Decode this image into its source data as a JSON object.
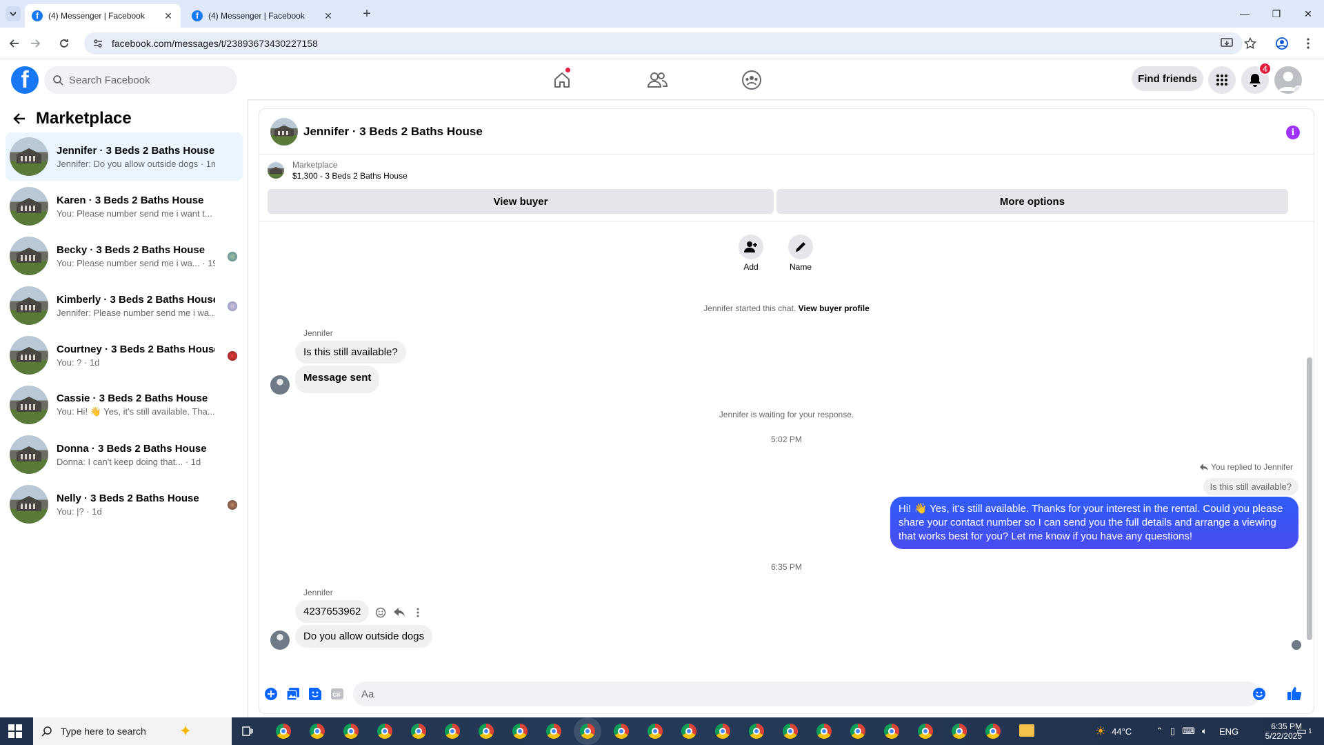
{
  "browser": {
    "tabs": [
      {
        "title": "(4) Messenger | Facebook",
        "active": true
      },
      {
        "title": "(4) Messenger | Facebook",
        "active": false
      }
    ],
    "url": "facebook.com/messages/t/23893673430227158"
  },
  "fb_header": {
    "search_placeholder": "Search Facebook",
    "find_friends": "Find friends",
    "notification_count": "4"
  },
  "sidebar": {
    "title": "Marketplace",
    "conversations": [
      {
        "name": "Jennifer · 3 Beds 2 Baths House",
        "preview": "Jennifer: Do you allow outside dogs · 1m",
        "selected": true
      },
      {
        "name": "Karen · 3 Beds 2 Baths House",
        "preview": "You: Please number send me i want t... · 1h"
      },
      {
        "name": "Becky · 3 Beds 2 Baths House",
        "preview": "You: Please number send me i wa... · 19h"
      },
      {
        "name": "Kimberly · 3 Beds 2 Baths House",
        "preview": "Jennifer: Please number send me i wa... · 19h"
      },
      {
        "name": "Courtney · 3 Beds 2 Baths House",
        "preview": "You: ? · 1d"
      },
      {
        "name": "Cassie · 3 Beds 2 Baths House",
        "preview": "You: Hi! 👋 Yes, it's still available. Tha... · 1d"
      },
      {
        "name": "Donna · 3 Beds 2 Baths House",
        "preview": "Donna: I can't keep doing that... · 1d"
      },
      {
        "name": "Nelly · 3 Beds 2 Baths House",
        "preview": "You: |? · 1d"
      }
    ]
  },
  "chat": {
    "title": "Jennifer · 3 Beds 2 Baths House",
    "listing_source": "Marketplace",
    "listing_title": "$1,300 - 3 Beds 2 Baths House",
    "view_buyer": "View buyer",
    "more_options": "More options",
    "add_label": "Add",
    "name_label": "Name",
    "started_text": "Jennifer started this chat.",
    "view_profile": "View buyer profile",
    "sender_name": "Jennifer",
    "msg1": "Is this still available?",
    "msg2": "Message sent",
    "waiting": "Jennifer is waiting for your response.",
    "time1": "5:02 PM",
    "replied_to": "You replied to Jennifer",
    "quoted": "Is this still available?",
    "my_reply": "Hi! 👋 Yes, it's still available. Thanks for your interest in the rental. Could you please share your contact number so I can send you the full details and arrange a viewing that works best for you? Let me know if you have any questions!",
    "time2": "6:35 PM",
    "msg3": "4237653962",
    "msg4": "Do you allow outside dogs",
    "composer_placeholder": "Aa"
  },
  "taskbar": {
    "search_placeholder": "Type here to search",
    "temperature": "44°C",
    "language": "ENG",
    "time": "6:35 PM",
    "date": "5/22/2025",
    "notif_count": "1"
  },
  "colors": {
    "facebook_blue": "#1877f2",
    "my_bubble": "#3b5bf5",
    "info_purple": "#a033ff",
    "badge_red": "#e41e3f"
  }
}
